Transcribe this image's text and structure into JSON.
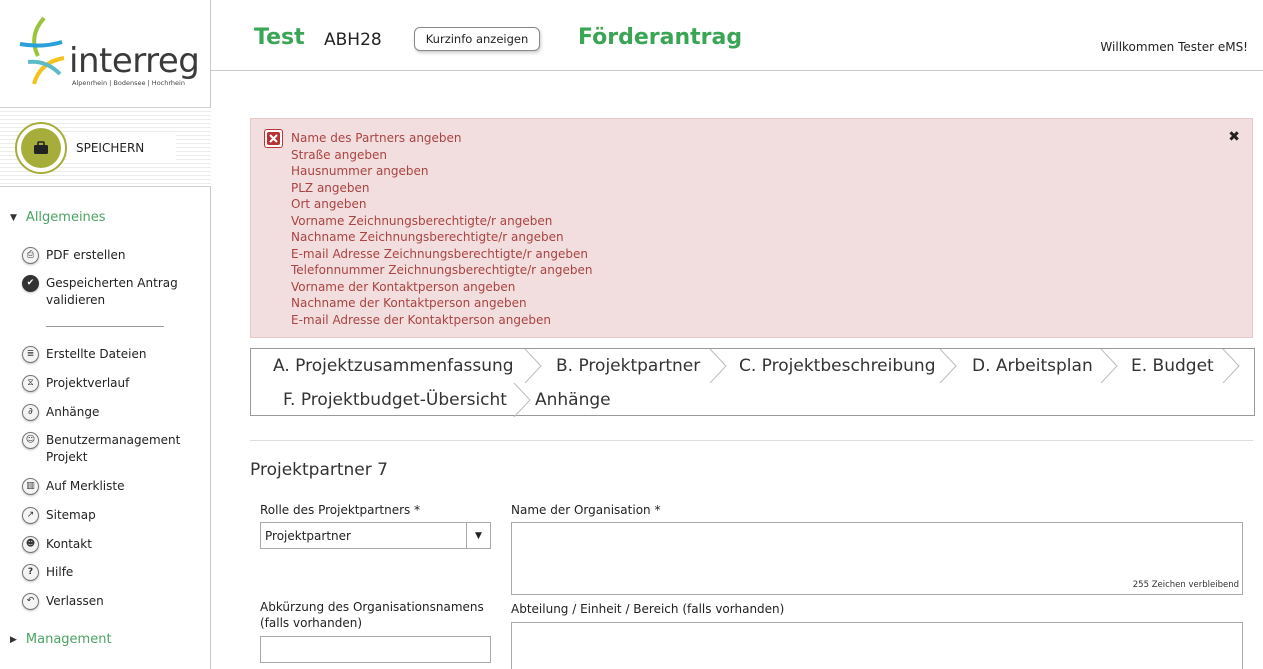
{
  "logo": {
    "word": "interreg",
    "subtitle": "Alpenrhein | Bodensee | Hochrhein"
  },
  "sidebar": {
    "save_label": "SPEICHERN",
    "section_general": "Allgemeines",
    "section_management": "Management",
    "items": [
      {
        "label": "PDF erstellen",
        "icon": "printer-icon"
      },
      {
        "label": "Gespeicherten Antrag validieren",
        "icon": "check-icon"
      },
      {
        "label": "Erstellte Dateien",
        "icon": "list-icon"
      },
      {
        "label": "Projektverlauf",
        "icon": "history-icon"
      },
      {
        "label": "Anhänge",
        "icon": "paperclip-icon"
      },
      {
        "label": "Benutzermanagement Projekt",
        "icon": "user-icon"
      },
      {
        "label": "Auf Merkliste",
        "icon": "bookmark-icon"
      },
      {
        "label": "Sitemap",
        "icon": "external-link-icon"
      },
      {
        "label": "Kontakt",
        "icon": "contact-icon"
      },
      {
        "label": "Hilfe",
        "icon": "help-icon"
      },
      {
        "label": "Verlassen",
        "icon": "exit-icon"
      }
    ]
  },
  "header": {
    "project_name": "Test",
    "project_code": "ABH28",
    "info_button": "Kurzinfo anzeigen",
    "title": "Förderantrag",
    "welcome": "Willkommen Tester eMS!"
  },
  "errors": [
    "Name des Partners angeben",
    "Straße angeben",
    "Hausnummer angeben",
    "PLZ angeben",
    "Ort angeben",
    "Vorname Zeichnungsberechtigte/r angeben",
    "Nachname Zeichnungsberechtigte/r angeben",
    "E-mail Adresse Zeichnungsberechtigte/r angeben",
    "Telefonnummer Zeichnungsberechtigte/r angeben",
    "Vorname der Kontaktperson angeben",
    "Nachname der Kontaktperson angeben",
    "E-mail Adresse der Kontaktperson angeben"
  ],
  "tabs": [
    "A. Projektzusammenfassung",
    "B. Projektpartner",
    "C. Projektbeschreibung",
    "D. Arbeitsplan",
    "E. Budget",
    "F. Projektbudget-Übersicht",
    "Anhänge"
  ],
  "form": {
    "section_title": "Projektpartner 7",
    "role_label": "Rolle des Projektpartners *",
    "role_value": "Projektpartner",
    "org_name_label": "Name der Organisation *",
    "org_name_counter": "255 Zeichen verbleibend",
    "abbr_label": "Abkürzung des Organisationsnamens (falls vorhanden)",
    "department_label": "Abteilung / Einheit / Bereich (falls vorhanden)"
  },
  "colors": {
    "accent_green": "#3aa555",
    "error_text": "#a94442",
    "error_bg": "#f2dede",
    "save_olive": "#a7ad3a"
  }
}
